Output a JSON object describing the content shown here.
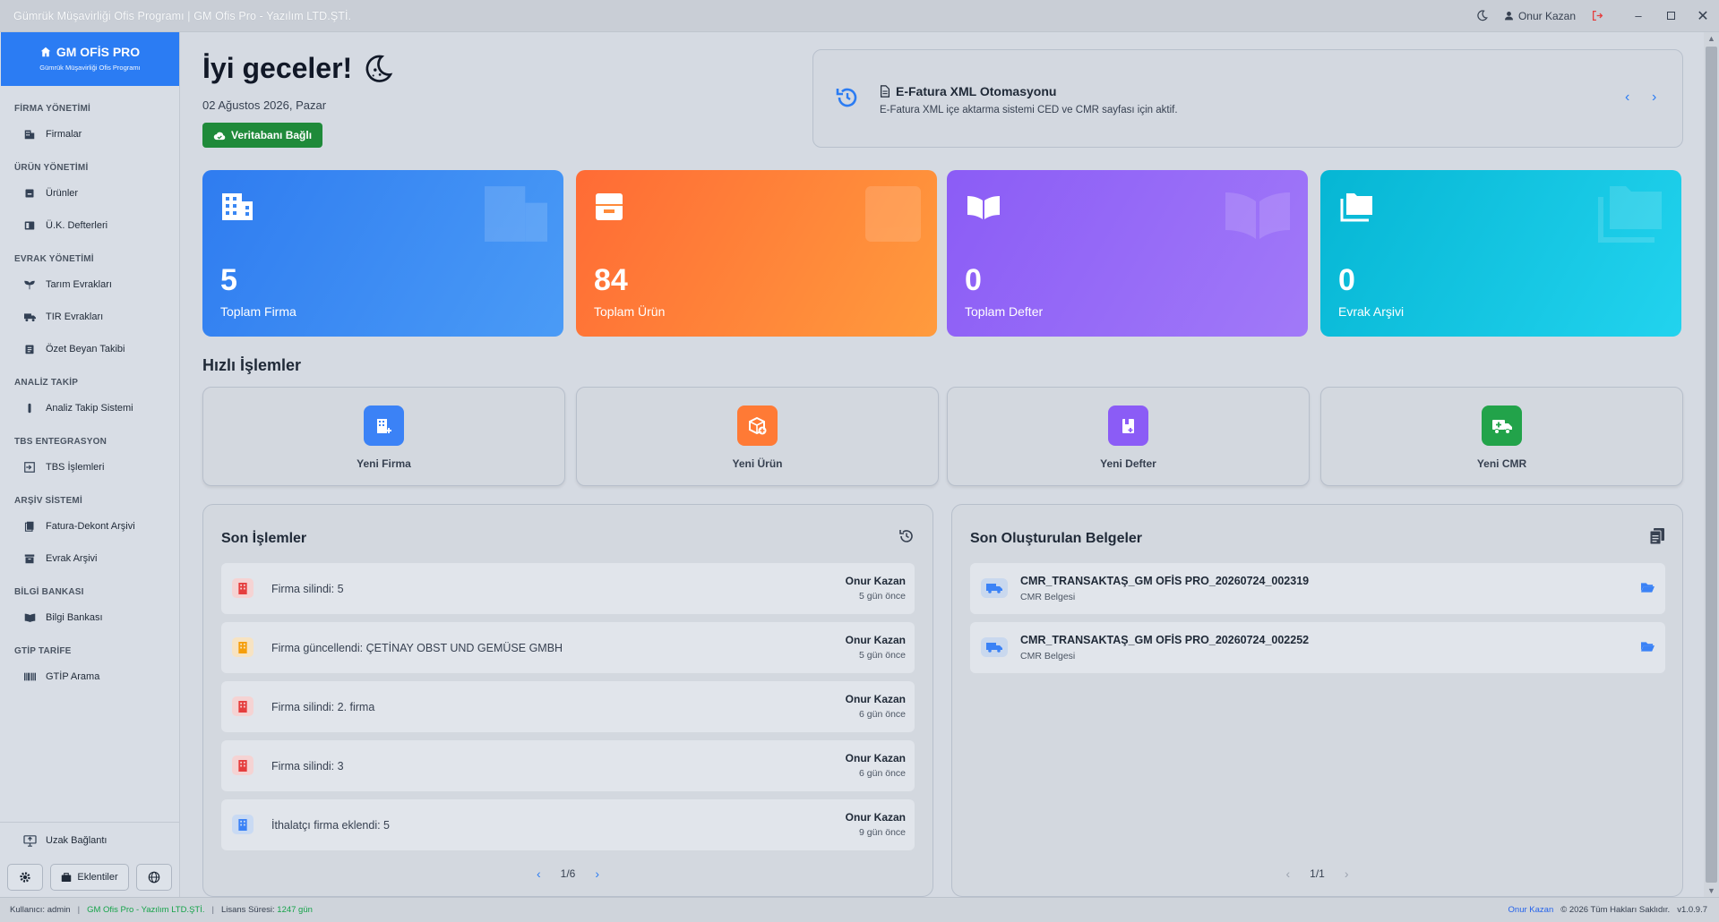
{
  "window": {
    "title": "Gümrük Müşavirliği Ofis Programı | GM Ofis Pro - Yazılım LTD.ŞTİ.",
    "user": "Onur Kazan"
  },
  "brand": {
    "title": "GM OFİS PRO",
    "subtitle": "Gümrük Müşavirliği Ofis Programı"
  },
  "sidebar": {
    "sections": [
      {
        "title": "FİRMA YÖNETİMİ",
        "items": [
          {
            "label": "Firmalar",
            "icon": "building-icon"
          }
        ]
      },
      {
        "title": "ÜRÜN YÖNETİMİ",
        "items": [
          {
            "label": "Ürünler",
            "icon": "box-icon"
          },
          {
            "label": "Ü.K. Defterleri",
            "icon": "book-icon"
          }
        ]
      },
      {
        "title": "EVRAK YÖNETİMİ",
        "items": [
          {
            "label": "Tarım Evrakları",
            "icon": "seedling-icon"
          },
          {
            "label": "TIR Evrakları",
            "icon": "truck-icon"
          },
          {
            "label": "Özet Beyan Takibi",
            "icon": "clipboard-icon"
          }
        ]
      },
      {
        "title": "ANALİZ TAKİP",
        "items": [
          {
            "label": "Analiz Takip Sistemi",
            "icon": "test-tube-icon"
          }
        ]
      },
      {
        "title": "TBS ENTEGRASYON",
        "items": [
          {
            "label": "TBS İşlemleri",
            "icon": "sign-in-icon"
          }
        ]
      },
      {
        "title": "ARŞİV SİSTEMİ",
        "items": [
          {
            "label": "Fatura-Dekont Arşivi",
            "icon": "files-icon"
          },
          {
            "label": "Evrak Arşivi",
            "icon": "archive-icon"
          }
        ]
      },
      {
        "title": "BİLGİ BANKASI",
        "items": [
          {
            "label": "Bilgi Bankası",
            "icon": "book-open-icon"
          }
        ]
      },
      {
        "title": "GTİP TARİFE",
        "items": [
          {
            "label": "GTİP Arama",
            "icon": "barcode-icon"
          }
        ]
      }
    ],
    "remote_label": "Uzak Bağlantı",
    "attachments_label": "Eklentiler"
  },
  "header": {
    "greeting": "İyi geceler!",
    "date": "02 Ağustos 2026, Pazar",
    "db_status": "Veritabanı Bağlı"
  },
  "notice": {
    "title": "E-Fatura XML Otomasyonu",
    "text": "E-Fatura XML içe aktarma sistemi CED ve CMR sayfası için aktif."
  },
  "stats": [
    {
      "value": "5",
      "label": "Toplam Firma"
    },
    {
      "value": "84",
      "label": "Toplam Ürün"
    },
    {
      "value": "0",
      "label": "Toplam Defter"
    },
    {
      "value": "0",
      "label": "Evrak Arşivi"
    }
  ],
  "quick": {
    "title": "Hızlı İşlemler",
    "actions": [
      {
        "label": "Yeni Firma"
      },
      {
        "label": "Yeni Ürün"
      },
      {
        "label": "Yeni Defter"
      },
      {
        "label": "Yeni CMR"
      }
    ]
  },
  "recent": {
    "title": "Son İşlemler",
    "rows": [
      {
        "text": "Firma silindi: 5",
        "user": "Onur Kazan",
        "time": "5 gün önce",
        "kind": "delete"
      },
      {
        "text": "Firma güncellendi: ÇETİNAY OBST UND GEMÜSE GMBH",
        "user": "Onur Kazan",
        "time": "5 gün önce",
        "kind": "update"
      },
      {
        "text": "Firma silindi: 2. firma",
        "user": "Onur Kazan",
        "time": "6 gün önce",
        "kind": "delete"
      },
      {
        "text": "Firma silindi: 3",
        "user": "Onur Kazan",
        "time": "6 gün önce",
        "kind": "delete"
      },
      {
        "text": "İthalatçı firma eklendi: 5",
        "user": "Onur Kazan",
        "time": "9 gün önce",
        "kind": "add"
      }
    ],
    "page": "1/6"
  },
  "docs": {
    "title": "Son Oluşturulan Belgeler",
    "rows": [
      {
        "name": "CMR_TRANSAKTAŞ_GM OFİS PRO_20260724_002319",
        "type": "CMR Belgesi"
      },
      {
        "name": "CMR_TRANSAKTAŞ_GM OFİS PRO_20260724_002252",
        "type": "CMR Belgesi"
      }
    ],
    "page": "1/1"
  },
  "status": {
    "user_label": "Kullanıcı:",
    "user": "admin",
    "company": "GM Ofis Pro - Yazılım LTD.ŞTİ.",
    "license_label": "Lisans Süresi:",
    "license": "1247 gün",
    "author": "Onur Kazan",
    "copyright": "© 2026 Tüm Hakları Saklıdır.",
    "version": "v1.0.9.7"
  },
  "colors": {
    "accent": "#2b7cf3",
    "firma": "#3b82f6",
    "urun": "#ff7a35",
    "defter": "#8b5cf6",
    "arsiv": "#06b6d4",
    "cmr": "#22a34a",
    "danger": "#e53e3e",
    "warning": "#f59e0b"
  }
}
